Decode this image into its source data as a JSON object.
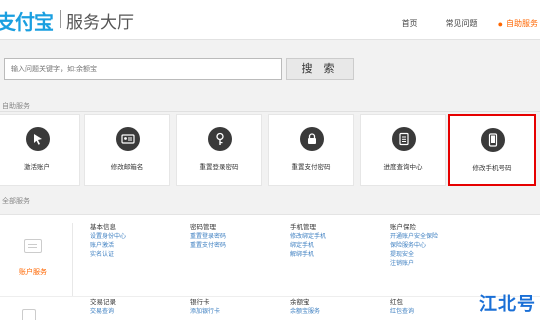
{
  "header": {
    "logo": "支付宝",
    "subtitle": "服务大厅",
    "nav": [
      "首页",
      "常见问题",
      "自助服务"
    ]
  },
  "search": {
    "placeholder": "输入问题关键字，如:余额宝",
    "button": "搜 索"
  },
  "sections": {
    "self_service": "自助服务",
    "all_service": "全部服务"
  },
  "cards": [
    {
      "label": "激活账户",
      "icon": "cursor-icon"
    },
    {
      "label": "修改邮箱名",
      "icon": "id-card-icon"
    },
    {
      "label": "重置登录密码",
      "icon": "key-icon"
    },
    {
      "label": "重置支付密码",
      "icon": "lock-icon"
    },
    {
      "label": "进度查询中心",
      "icon": "document-icon"
    },
    {
      "label": "修改手机号码",
      "icon": "phone-icon"
    }
  ],
  "account": {
    "label": "账户服务"
  },
  "columns": [
    {
      "head": "基本信息",
      "items": [
        "设置身份中心",
        "账户激活",
        "实名认证"
      ]
    },
    {
      "head": "密码管理",
      "items": [
        "重置登录密码",
        "重置支付密码"
      ]
    },
    {
      "head": "手机管理",
      "items": [
        "修改绑定手机",
        "绑定手机",
        "解绑手机"
      ]
    },
    {
      "head": "账户保险",
      "items": [
        "开通账户安全保险",
        "保险服务中心",
        "提现安全",
        "注销账户"
      ]
    }
  ],
  "columns2": [
    {
      "head": "交易记录",
      "items": [
        "交易查询"
      ]
    },
    {
      "head": "银行卡",
      "items": [
        "添加银行卡"
      ]
    },
    {
      "head": "余额宝",
      "items": [
        "余额宝服务"
      ]
    },
    {
      "head": "红包",
      "items": [
        "红包查询"
      ]
    }
  ],
  "watermark": "江北号",
  "colors": {
    "brand": "#1a9fe0",
    "accent": "#ff6600",
    "highlight": "#e60000",
    "link": "#3d7fc1"
  }
}
